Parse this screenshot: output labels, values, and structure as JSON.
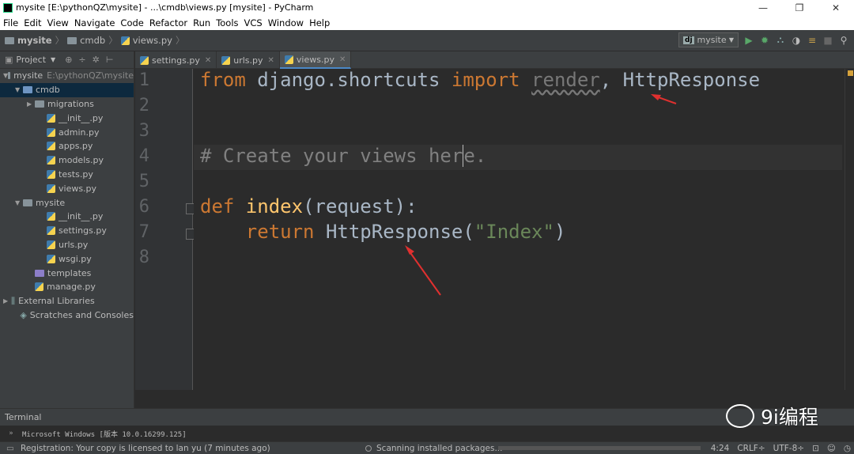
{
  "window": {
    "title": "mysite [E:\\pythonQZ\\mysite] - ...\\cmdb\\views.py [mysite] - PyCharm",
    "controls": [
      "—",
      "❐",
      "✕"
    ]
  },
  "menu": [
    "File",
    "Edit",
    "View",
    "Navigate",
    "Code",
    "Refactor",
    "Run",
    "Tools",
    "VCS",
    "Window",
    "Help"
  ],
  "breadcrumb": [
    "mysite",
    "cmdb",
    "views.py"
  ],
  "run_config": {
    "badge": "dj",
    "name": "mysite"
  },
  "project_panel": {
    "label": "Project"
  },
  "tree": [
    {
      "label": "mysite",
      "path": "E:\\pythonQZ\\mysite",
      "indent": 0,
      "arrow": "▼",
      "icon": "folder"
    },
    {
      "label": "cmdb",
      "path": "",
      "indent": 1,
      "arrow": "▼",
      "icon": "folder-blue",
      "selected": true
    },
    {
      "label": "migrations",
      "path": "",
      "indent": 2,
      "arrow": "▶",
      "icon": "folder"
    },
    {
      "label": "__init__.py",
      "path": "",
      "indent": 3,
      "arrow": "",
      "icon": "py"
    },
    {
      "label": "admin.py",
      "path": "",
      "indent": 3,
      "arrow": "",
      "icon": "py"
    },
    {
      "label": "apps.py",
      "path": "",
      "indent": 3,
      "arrow": "",
      "icon": "py"
    },
    {
      "label": "models.py",
      "path": "",
      "indent": 3,
      "arrow": "",
      "icon": "py"
    },
    {
      "label": "tests.py",
      "path": "",
      "indent": 3,
      "arrow": "",
      "icon": "py"
    },
    {
      "label": "views.py",
      "path": "",
      "indent": 3,
      "arrow": "",
      "icon": "py"
    },
    {
      "label": "mysite",
      "path": "",
      "indent": 1,
      "arrow": "▼",
      "icon": "folder"
    },
    {
      "label": "__init__.py",
      "path": "",
      "indent": 3,
      "arrow": "",
      "icon": "py"
    },
    {
      "label": "settings.py",
      "path": "",
      "indent": 3,
      "arrow": "",
      "icon": "py"
    },
    {
      "label": "urls.py",
      "path": "",
      "indent": 3,
      "arrow": "",
      "icon": "py"
    },
    {
      "label": "wsgi.py",
      "path": "",
      "indent": 3,
      "arrow": "",
      "icon": "py"
    },
    {
      "label": "templates",
      "path": "",
      "indent": 2,
      "arrow": "",
      "icon": "folder-purple"
    },
    {
      "label": "manage.py",
      "path": "",
      "indent": 2,
      "arrow": "",
      "icon": "py"
    },
    {
      "label": "External Libraries",
      "path": "",
      "indent": 0,
      "arrow": "▶",
      "icon": "lib"
    },
    {
      "label": "Scratches and Consoles",
      "path": "",
      "indent": 1,
      "arrow": "",
      "icon": "scratch"
    }
  ],
  "tabs": [
    {
      "label": "settings.py",
      "active": false
    },
    {
      "label": "urls.py",
      "active": false
    },
    {
      "label": "views.py",
      "active": true
    }
  ],
  "line_numbers": [
    "1",
    "2",
    "3",
    "4",
    "5",
    "6",
    "7",
    "8"
  ],
  "code": {
    "l1_from": "from",
    "l1_mod": " django.shortcuts ",
    "l1_import": "import",
    "l1_render": "render",
    "l1_rest": ", HttpResponse",
    "l4_comment_a": "# Create your views her",
    "l4_comment_b": "e.",
    "l6_def": "def",
    "l6_name": " index",
    "l6_rest": "(request):",
    "l7_return": "return",
    "l7_call": " HttpResponse(",
    "l7_str": "\"Index\"",
    "l7_close": ")"
  },
  "terminal": {
    "label": "Terminal",
    "output": "Microsoft Windows [版本 10.0.16299.125]"
  },
  "status": {
    "registration": "Registration: Your copy is licensed to lan yu (7 minutes ago)",
    "task": "Scanning installed packages...",
    "position": "4:24",
    "line_sep": "CRLF÷",
    "encoding": "UTF-8÷"
  },
  "watermark": {
    "text": "9i编程"
  },
  "colors": {
    "accent": "#4a88c7",
    "keyword": "#cc7832",
    "function": "#ffc66d",
    "string": "#6a8759",
    "comment": "#808080",
    "arrow": "#e0302f"
  }
}
